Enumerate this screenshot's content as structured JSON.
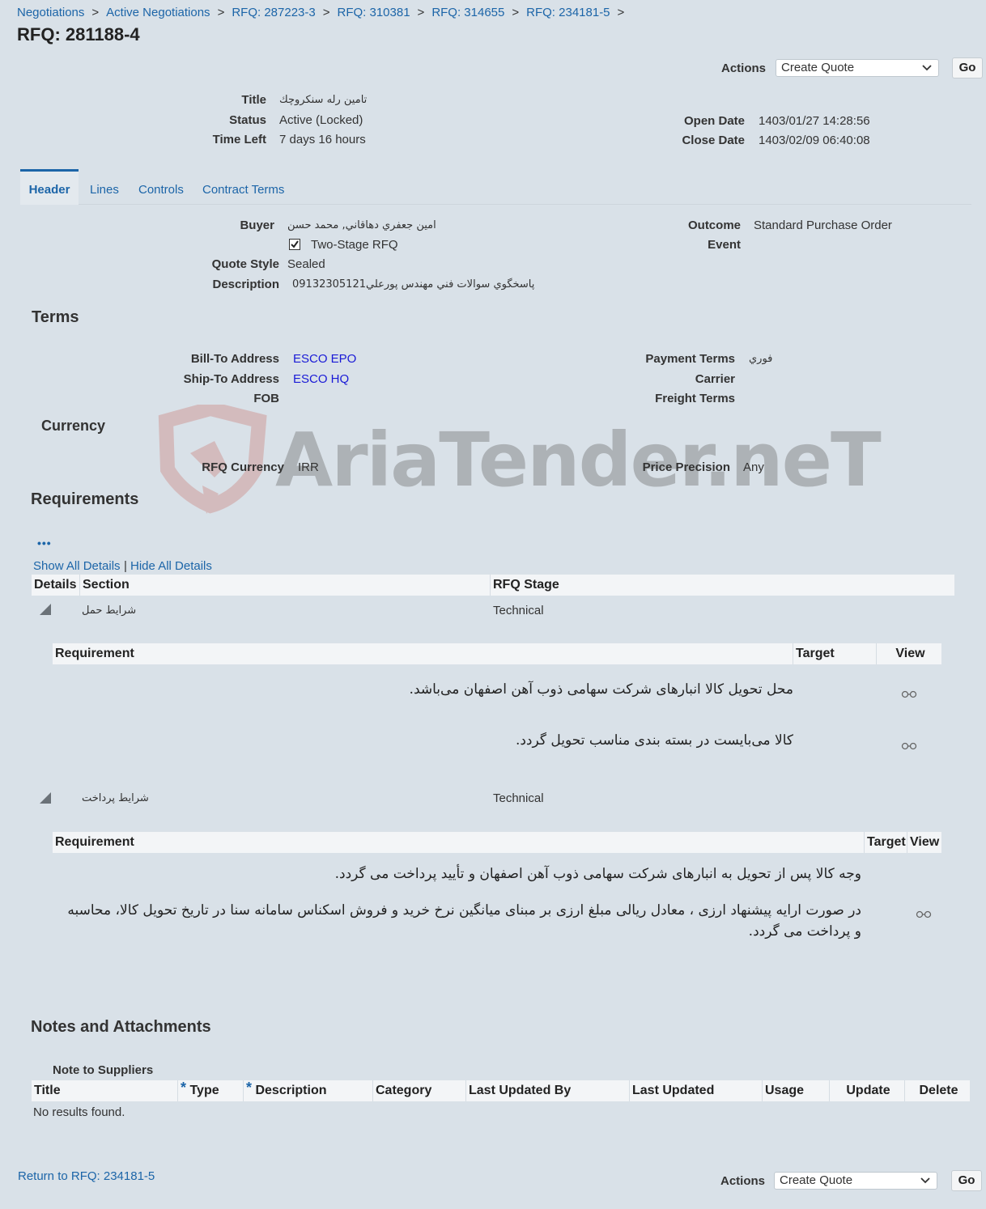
{
  "breadcrumbs": [
    "Negotiations",
    "Active Negotiations",
    "RFQ: 287223-3",
    "RFQ: 310381",
    "RFQ: 314655",
    "RFQ: 234181-5"
  ],
  "breadcrumb_sep": ">",
  "page_title": "RFQ: 281188-4",
  "actions": {
    "label": "Actions",
    "selected": "Create Quote",
    "go": "Go"
  },
  "summary": {
    "title_label": "Title",
    "title_value": "تامين رله سنكروچك",
    "status_label": "Status",
    "status_value": "Active (Locked)",
    "time_left_label": "Time Left",
    "time_left_value": "7 days 16 hours",
    "open_date_label": "Open Date",
    "open_date_value": "1403/01/27 14:28:56",
    "close_date_label": "Close Date",
    "close_date_value": "1403/02/09 06:40:08"
  },
  "tabs": [
    "Header",
    "Lines",
    "Controls",
    "Contract Terms"
  ],
  "header": {
    "buyer_label": "Buyer",
    "buyer_value": "امين جعفري دهاقاني, محمد حسن",
    "two_stage_label": "Two-Stage RFQ",
    "quote_style_label": "Quote Style",
    "quote_style_value": "Sealed",
    "description_label": "Description",
    "description_value": "پاسخگوي سوالات فني مهندس پورعلي09132305121",
    "outcome_label": "Outcome",
    "outcome_value": "Standard Purchase Order",
    "event_label": "Event"
  },
  "terms": {
    "heading": "Terms",
    "bill_to_label": "Bill-To Address",
    "bill_to_value": "ESCO EPO",
    "ship_to_label": "Ship-To Address",
    "ship_to_value": "ESCO HQ",
    "fob_label": "FOB",
    "payment_terms_label": "Payment Terms",
    "payment_terms_value": "فوري",
    "carrier_label": "Carrier",
    "freight_terms_label": "Freight Terms"
  },
  "currency": {
    "heading": "Currency",
    "rfq_currency_label": "RFQ Currency",
    "rfq_currency_value": "IRR",
    "price_precision_label": "Price Precision",
    "price_precision_value": "Any"
  },
  "watermark": {
    "text": "AriaTender.neT"
  },
  "requirements": {
    "heading": "Requirements",
    "more_icon": "•••",
    "show_all": "Show All Details",
    "details_sep": "|",
    "hide_all": "Hide All Details",
    "columns": [
      "Details",
      "Section",
      "RFQ Stage"
    ],
    "sub_columns": [
      "Requirement",
      "Target",
      "View"
    ],
    "sections": [
      {
        "name": "شرايط حمل",
        "stage": "Technical",
        "items": [
          "محل تحویل کالا انبارهای شرکت سهامی ذوب آهن اصفهان می‌باشد.",
          "کالا می‌بایست در بسته بندی مناسب تحویل گردد."
        ]
      },
      {
        "name": "شرايط پرداخت",
        "stage": "Technical",
        "items": [
          "وجه کالا پس از تحویل به انبارهای شرکت سهامی ذوب آهن اصفهان و تأیید پرداخت می گردد.",
          "در صورت ارایه پیشنهاد ارزی ، معادل ریالی مبلغ ارزی بر مبنای میانگین نرخ خرید و فروش اسکناس سامانه سنا در تاریخ تحویل کالا، محاسبه و پرداخت می گردد."
        ]
      }
    ]
  },
  "notes": {
    "heading": "Notes and Attachments",
    "note_to_suppliers": "Note to Suppliers",
    "required_mark": "*",
    "columns": [
      "Title",
      "Type",
      "Description",
      "Category",
      "Last Updated By",
      "Last Updated",
      "Usage",
      "Update",
      "Delete"
    ],
    "empty": "No results found."
  },
  "footer": {
    "return_link": "Return to RFQ: 234181-5"
  }
}
